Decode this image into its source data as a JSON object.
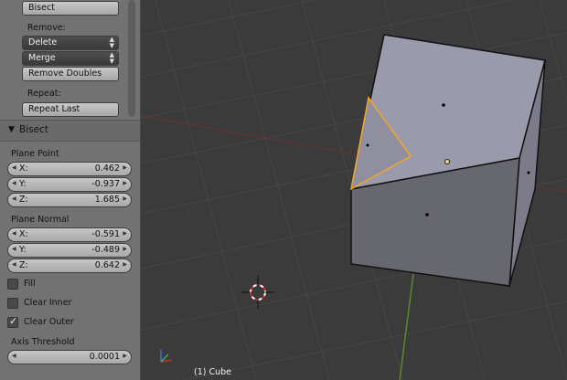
{
  "tool_shelf": {
    "bisect_button": "Bisect",
    "remove_label": "Remove:",
    "delete_dropdown": "Delete",
    "merge_dropdown": "Merge",
    "remove_doubles_button": "Remove Doubles",
    "repeat_label": "Repeat:",
    "repeat_last_button": "Repeat Last"
  },
  "operator_panel": {
    "title": "Bisect",
    "plane_point": {
      "label": "Plane Point",
      "x_label": "X:",
      "x": "0.462",
      "y_label": "Y:",
      "y": "-0.937",
      "z_label": "Z:",
      "z": "1.685"
    },
    "plane_normal": {
      "label": "Plane Normal",
      "x_label": "X:",
      "x": "-0.591",
      "y_label": "Y:",
      "y": "-0.489",
      "z_label": "Z:",
      "z": "0.642"
    },
    "fill": {
      "label": "Fill",
      "checked": false
    },
    "clear_inner": {
      "label": "Clear Inner",
      "checked": false
    },
    "clear_outer": {
      "label": "Clear Outer",
      "checked": true
    },
    "axis_threshold": {
      "label": "Axis Threshold",
      "value": "0.0001"
    }
  },
  "viewport": {
    "object_label": "(1) Cube"
  },
  "colors": {
    "grid": "#474747",
    "background": "#3b3b3b",
    "panel": "#727272",
    "selection": "#f5a623",
    "cube_top": "#9a9aad",
    "cube_front": "#67676f",
    "cube_side": "#7b7b89"
  }
}
